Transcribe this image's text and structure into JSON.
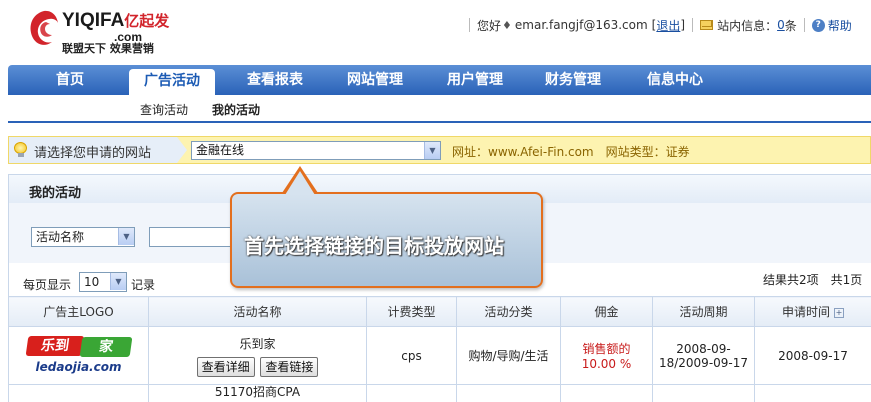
{
  "header": {
    "brand": "YIQIFA",
    "brand_cn": "亿起发",
    "brand_suffix": ".com",
    "slogan": "联盟天下 效果营销",
    "greeting": "您好",
    "email": "emar.fangjf@163.com",
    "logout_open": "[",
    "logout_label": "退出",
    "logout_close": "]",
    "inbox_label": "站内信息：",
    "inbox_count": "0",
    "inbox_unit": "条",
    "help_label": "帮助"
  },
  "nav": {
    "items": [
      {
        "label": "首页"
      },
      {
        "label": "广告活动",
        "active": true
      },
      {
        "label": "查看报表"
      },
      {
        "label": "网站管理"
      },
      {
        "label": "用户管理"
      },
      {
        "label": "财务管理"
      },
      {
        "label": "信息中心"
      }
    ],
    "sub_items": [
      {
        "label": "查询活动"
      },
      {
        "label": "我的活动",
        "active": true
      }
    ]
  },
  "site_bar": {
    "label": "请选择您申请的网站",
    "selected": "金融在线",
    "info": "网址：www.Afei-Fin.com　网站类型：证券"
  },
  "section": {
    "title": "我的活动",
    "filter_select": "活动名称",
    "per_page_label": "每页显示",
    "per_page_value": "10",
    "per_page_unit": "记录",
    "result_text": "结果共2项　共1页"
  },
  "table": {
    "headers": [
      "广告主LOGO",
      "活动名称",
      "计费类型",
      "活动分类",
      "佣金",
      "活动周期",
      "申请时间"
    ],
    "rows": [
      {
        "logo_red": "乐到",
        "logo_green": "家",
        "logo_url": "ledaojia.com",
        "name": "乐到家",
        "btn_detail": "查看详细",
        "btn_link": "查看链接",
        "billing": "cps",
        "category": "购物/导购/生活",
        "commission_label": "销售额的",
        "commission_value": "10.00 %",
        "period": "2008-09-18/2009-09-17",
        "applied": "2008-09-17"
      }
    ],
    "partial_row_name": "51170招商CPA"
  },
  "callout": {
    "text": "首先选择链接的目标投放网站"
  }
}
